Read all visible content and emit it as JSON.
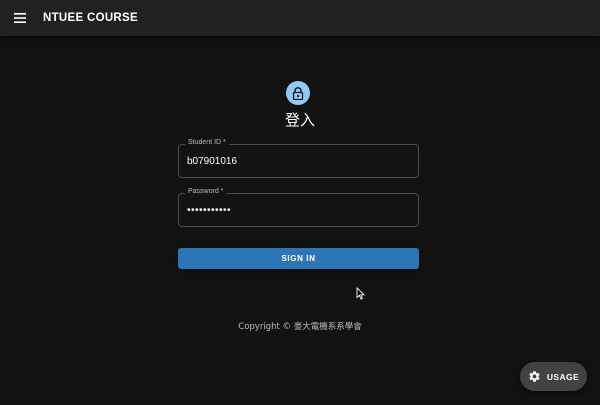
{
  "appbar": {
    "menu_icon": "hamburger-menu-icon",
    "title": "NTUEE COURSE"
  },
  "login": {
    "avatar_icon": "lock-icon",
    "avatar_color": "#90caf9",
    "title": "登入",
    "student_id": {
      "label": "Student ID *",
      "value": "b07901016"
    },
    "password": {
      "label": "Password *",
      "value": "•••••••••••"
    },
    "signin_label": "SIGN IN",
    "signin_color": "#2e75b6"
  },
  "footer": {
    "copyright": "Copyright © 臺大電機系系學會"
  },
  "usage_button": {
    "icon": "gear-icon",
    "label": "USAGE"
  }
}
